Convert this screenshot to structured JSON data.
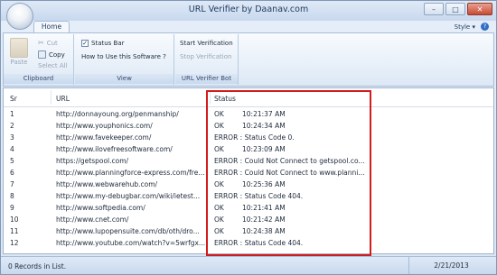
{
  "window": {
    "title": "URL Verifier by Daanav.com",
    "min": "–",
    "max": "□",
    "close": "✕"
  },
  "tabs": {
    "home": "Home",
    "style": "Style",
    "style_arrow": "▾",
    "help": "?"
  },
  "ribbon": {
    "clipboard": {
      "label": "Clipboard",
      "paste": "Paste",
      "cut": "Cut",
      "copy": "Copy",
      "select_all": "Select All"
    },
    "view": {
      "label": "View",
      "status_bar": "Status Bar",
      "status_bar_checked": "✓",
      "how_to": "How to Use this Software ?"
    },
    "bot": {
      "label": "URL Verifier Bot",
      "start": "Start Verification",
      "stop": "Stop Verification"
    }
  },
  "list": {
    "columns": {
      "sr": "Sr",
      "url": "URL",
      "status": "Status"
    },
    "rows": [
      {
        "sr": "1",
        "url": "http://donnayoung.org/penmanship/",
        "status": "OK",
        "time": "10:21:37 AM"
      },
      {
        "sr": "2",
        "url": "http://www.youphonics.com/",
        "status": "OK",
        "time": "10:24:34 AM"
      },
      {
        "sr": "3",
        "url": "http://www.favekeeper.com/",
        "status": "ERROR : Status Code 0.",
        "time": ""
      },
      {
        "sr": "4",
        "url": "http://www.ilovefreesoftware.com/",
        "status": "OK",
        "time": "10:23:09 AM"
      },
      {
        "sr": "5",
        "url": "https://getspool.com/",
        "status": "ERROR : Could Not Connect to getspool.co...",
        "time": ""
      },
      {
        "sr": "6",
        "url": "http://www.planningforce-express.com/fre...",
        "status": "ERROR : Could Not Connect to www.planni...",
        "time": ""
      },
      {
        "sr": "7",
        "url": "http://www.webwarehub.com/",
        "status": "OK",
        "time": "10:25:36 AM"
      },
      {
        "sr": "8",
        "url": "http://www.my-debugbar.com/wiki/ietest...",
        "status": "ERROR : Status Code 404.",
        "time": ""
      },
      {
        "sr": "9",
        "url": "http://www.softpedia.com/",
        "status": "OK",
        "time": "10:21:41 AM"
      },
      {
        "sr": "10",
        "url": "http://www.cnet.com/",
        "status": "OK",
        "time": "10:21:42 AM"
      },
      {
        "sr": "11",
        "url": "http://www.lupopensuite.com/db/oth/dro...",
        "status": "OK",
        "time": "10:24:38 AM"
      },
      {
        "sr": "12",
        "url": "http://www.youtube.com/watch?v=5wrfgx...",
        "status": "ERROR : Status Code 404.",
        "time": ""
      }
    ]
  },
  "statusbar": {
    "records": "0 Records in List.",
    "date": "2/21/2013"
  },
  "colors": {
    "highlight": "#d41b1b",
    "accent": "#2f6fc4"
  }
}
